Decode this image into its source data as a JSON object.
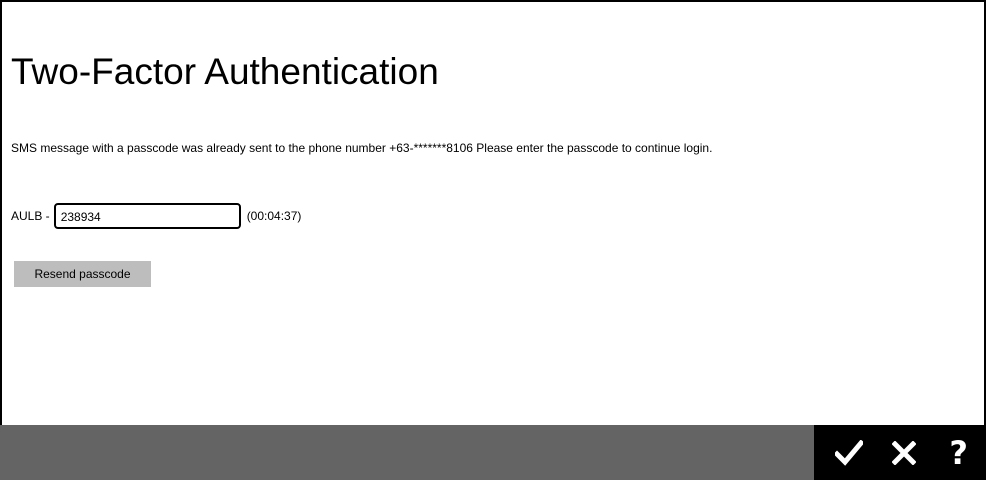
{
  "page": {
    "title": "Two-Factor Authentication",
    "message": "SMS message with a passcode was already sent to the phone number +63-*******8106 Please enter the passcode to continue login."
  },
  "passcode": {
    "prefix": "AULB -",
    "value": "238934",
    "timer": "(00:04:37)"
  },
  "buttons": {
    "resend_label": "Resend passcode"
  },
  "footer": {
    "actions": [
      {
        "name": "confirm",
        "icon": "checkmark-icon"
      },
      {
        "name": "cancel",
        "icon": "close-icon"
      },
      {
        "name": "help",
        "icon": "help-icon",
        "glyph": "?"
      }
    ]
  },
  "colors": {
    "footer_bar": "#646464",
    "action_panel": "#000000",
    "resend_button": "#bdbdbd"
  }
}
